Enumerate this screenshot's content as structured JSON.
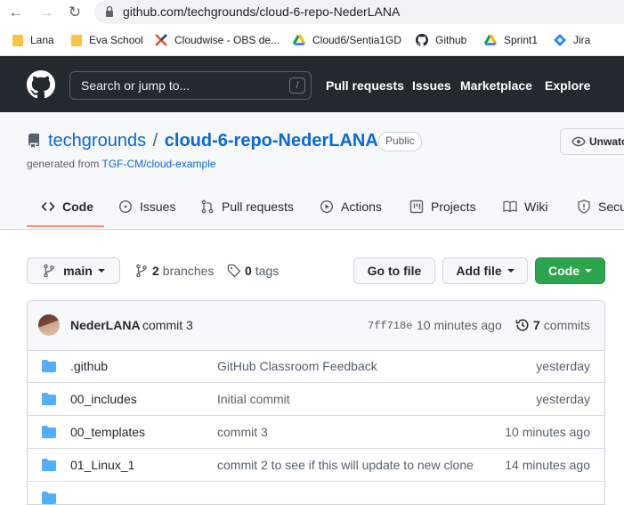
{
  "browser": {
    "url": "github.com/techgrounds/cloud-6-repo-NederLANA",
    "bookmarks": [
      {
        "label": "Lana",
        "icon": "folder-icon"
      },
      {
        "label": "Eva School",
        "icon": "folder-icon"
      },
      {
        "label": "Cloudwise - OBS de...",
        "icon": "cloudwise-icon"
      },
      {
        "label": "Cloud6/Sentia1GD",
        "icon": "google-drive-icon"
      },
      {
        "label": "Github",
        "icon": "github-icon"
      },
      {
        "label": "Sprint1",
        "icon": "google-drive-icon"
      },
      {
        "label": "Jira",
        "icon": "jira-icon"
      }
    ]
  },
  "header": {
    "search_placeholder": "Search or jump to...",
    "search_shortcut": "/",
    "nav": [
      "Pull requests",
      "Issues",
      "Marketplace",
      "Explore"
    ]
  },
  "repo": {
    "owner": "techgrounds",
    "separator": "/",
    "name": "cloud-6-repo-NederLANA",
    "visibility": "Public",
    "generated_prefix": "generated from",
    "generated_from": "TGF-CM/cloud-example",
    "unwatch_label": "Unwatc"
  },
  "tabs": [
    {
      "label": "Code",
      "icon": "code-icon",
      "selected": true
    },
    {
      "label": "Issues",
      "icon": "issue-opened-icon"
    },
    {
      "label": "Pull requests",
      "icon": "git-pull-request-icon"
    },
    {
      "label": "Actions",
      "icon": "play-icon"
    },
    {
      "label": "Projects",
      "icon": "table-icon"
    },
    {
      "label": "Wiki",
      "icon": "book-icon"
    },
    {
      "label": "Secu",
      "icon": "shield-icon"
    }
  ],
  "controls": {
    "branch": "main",
    "branches_count": "2",
    "branches_label": "branches",
    "tags_count": "0",
    "tags_label": "tags",
    "go_to_file": "Go to file",
    "add_file": "Add file",
    "code": "Code"
  },
  "latest_commit": {
    "author": "NederLANA",
    "message": "commit 3",
    "sha": "7ff718e",
    "time": "10 minutes ago",
    "commits_count": "7",
    "commits_label": "commits"
  },
  "files": [
    {
      "name": ".github",
      "message": "GitHub Classroom Feedback",
      "age": "yesterday"
    },
    {
      "name": "00_includes",
      "message": "Initial commit",
      "age": "yesterday"
    },
    {
      "name": "00_templates",
      "message": "commit 3",
      "age": "10 minutes ago"
    },
    {
      "name": "01_Linux_1",
      "message": "commit 2 to see if this will update to new clone",
      "age": "14 minutes ago"
    }
  ],
  "colors": {
    "header_bg": "#24292f",
    "link": "#0969da",
    "green": "#2da44e",
    "tab_underline": "#fd8c73",
    "folder": "#54aeff"
  }
}
